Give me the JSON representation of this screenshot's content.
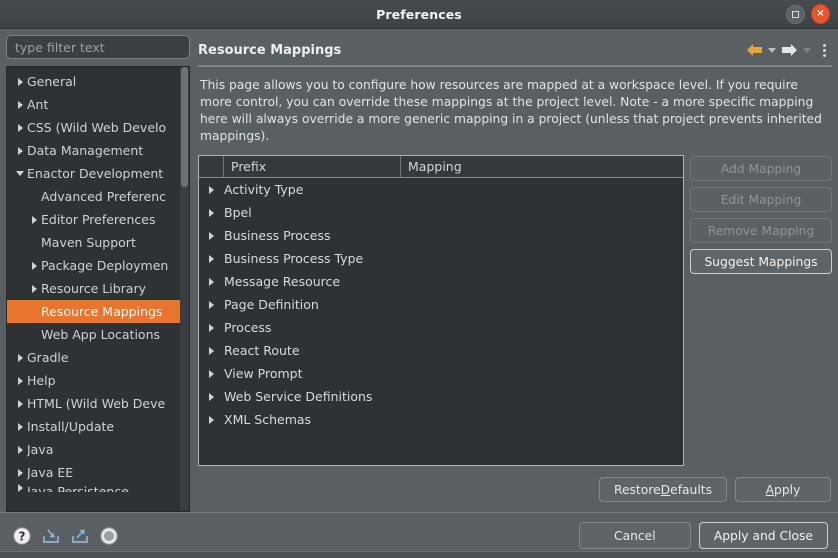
{
  "window": {
    "title": "Preferences",
    "maximize_icon": "maximize-square-icon",
    "close_icon": "close-x-icon",
    "close_label": "×"
  },
  "sidebar": {
    "filter": {
      "value": "",
      "placeholder": "type filter text"
    },
    "items": [
      {
        "label": "General",
        "arrow": "right",
        "indent": 1,
        "selected": false
      },
      {
        "label": "Ant",
        "arrow": "right",
        "indent": 1,
        "selected": false
      },
      {
        "label": "CSS (Wild Web Develo",
        "arrow": "right",
        "indent": 1,
        "selected": false
      },
      {
        "label": "Data Management",
        "arrow": "right",
        "indent": 1,
        "selected": false
      },
      {
        "label": "Enactor Development",
        "arrow": "down",
        "indent": 1,
        "selected": false
      },
      {
        "label": "Advanced Preferenc",
        "arrow": "none",
        "indent": 2,
        "selected": false
      },
      {
        "label": "Editor Preferences",
        "arrow": "right",
        "indent": 2,
        "selected": false
      },
      {
        "label": "Maven Support",
        "arrow": "none",
        "indent": 2,
        "selected": false
      },
      {
        "label": "Package Deploymen",
        "arrow": "right",
        "indent": 2,
        "selected": false
      },
      {
        "label": "Resource Library",
        "arrow": "right",
        "indent": 2,
        "selected": false
      },
      {
        "label": "Resource Mappings",
        "arrow": "none",
        "indent": 2,
        "selected": true
      },
      {
        "label": "Web App Locations",
        "arrow": "none",
        "indent": 2,
        "selected": false
      },
      {
        "label": "Gradle",
        "arrow": "right",
        "indent": 1,
        "selected": false
      },
      {
        "label": "Help",
        "arrow": "right",
        "indent": 1,
        "selected": false
      },
      {
        "label": "HTML (Wild Web Deve",
        "arrow": "right",
        "indent": 1,
        "selected": false
      },
      {
        "label": "Install/Update",
        "arrow": "right",
        "indent": 1,
        "selected": false
      },
      {
        "label": "Java",
        "arrow": "right",
        "indent": 1,
        "selected": false
      },
      {
        "label": "Java EE",
        "arrow": "right",
        "indent": 1,
        "selected": false
      },
      {
        "label": "Java Persistence",
        "arrow": "right",
        "indent": 1,
        "selected": false,
        "clipped": true
      }
    ]
  },
  "page": {
    "title": "Resource Mappings",
    "nav": {
      "back_icon": "arrow-left-icon",
      "back_menu_icon": "chevron-down-icon",
      "forward_icon": "arrow-right-icon",
      "forward_menu_icon": "chevron-down-icon",
      "menu_icon": "kebab-menu-icon"
    },
    "description": "This page allows you to configure how resources are mapped at a workspace level. If you require more control, you can override these mappings at the project level. Note - a more specific mapping here will always override a more generic mapping in a project (unless that project prevents inherited mappings).",
    "table": {
      "columns": [
        "",
        "Prefix",
        "Mapping"
      ],
      "rows": [
        {
          "expander": "expand-arrow-icon",
          "prefix": "Activity Type",
          "mapping": ""
        },
        {
          "expander": "expand-arrow-icon",
          "prefix": "Bpel",
          "mapping": ""
        },
        {
          "expander": "expand-arrow-icon",
          "prefix": "Business Process",
          "mapping": ""
        },
        {
          "expander": "expand-arrow-icon",
          "prefix": "Business Process Type",
          "mapping": ""
        },
        {
          "expander": "expand-arrow-icon",
          "prefix": "Message Resource",
          "mapping": ""
        },
        {
          "expander": "expand-arrow-icon",
          "prefix": "Page Definition",
          "mapping": ""
        },
        {
          "expander": "expand-arrow-icon",
          "prefix": "Process",
          "mapping": ""
        },
        {
          "expander": "expand-arrow-icon",
          "prefix": "React Route",
          "mapping": ""
        },
        {
          "expander": "expand-arrow-icon",
          "prefix": "View Prompt",
          "mapping": ""
        },
        {
          "expander": "expand-arrow-icon",
          "prefix": "Web Service Definitions",
          "mapping": ""
        },
        {
          "expander": "expand-arrow-icon",
          "prefix": "XML Schemas",
          "mapping": ""
        }
      ]
    },
    "side_buttons": [
      {
        "label": "Add Mapping",
        "enabled": false
      },
      {
        "label": "Edit Mapping",
        "enabled": false
      },
      {
        "label": "Remove Mapping",
        "enabled": false
      },
      {
        "label": "Suggest Mappings",
        "enabled": true
      }
    ],
    "actions": {
      "restore_defaults": {
        "pre": "Restore ",
        "mnemonic": "D",
        "post": "efaults"
      },
      "apply": {
        "pre": "",
        "mnemonic": "A",
        "post": "pply"
      }
    }
  },
  "footer": {
    "icons": [
      {
        "name": "help-question-icon"
      },
      {
        "name": "import-icon"
      },
      {
        "name": "export-icon"
      },
      {
        "name": "record-circle-icon"
      }
    ],
    "cancel_label": "Cancel",
    "apply_and_close_label": "Apply and Close"
  },
  "colors": {
    "accent_selected": "#e8742e",
    "window_bg": "#595f63",
    "tree_bg": "#2e3234",
    "close_button": "#e8562f",
    "nav_back_arrow": "#e8a33d"
  }
}
